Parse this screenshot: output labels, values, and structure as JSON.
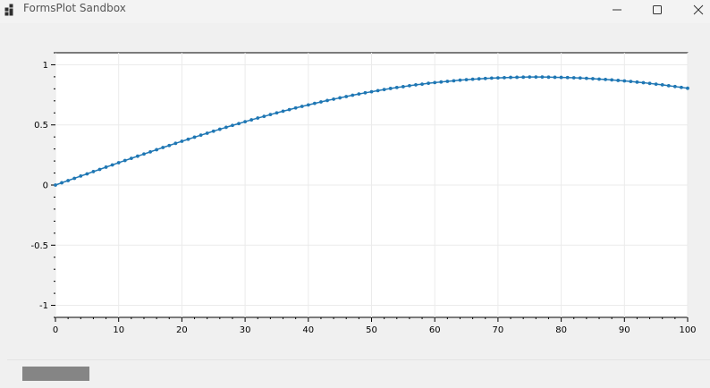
{
  "window": {
    "title": "FormsPlot Sandbox",
    "app_icon": "grid-app-icon",
    "controls": [
      "minimize-icon",
      "maximize-icon",
      "close-icon"
    ]
  },
  "chart_data": {
    "type": "scatter",
    "title": "",
    "xlabel": "",
    "ylabel": "",
    "xlim": [
      0,
      100
    ],
    "ylim": [
      -1.1,
      1.1
    ],
    "x_ticks": [
      "0",
      "10",
      "20",
      "30",
      "40",
      "50",
      "60",
      "70",
      "80",
      "90",
      "100"
    ],
    "y_ticks": [
      "1",
      "0.5",
      "0",
      "-0.5",
      "-1"
    ],
    "grid": true,
    "marker": "circle",
    "line": true,
    "color": "#1f77b4",
    "series": [
      {
        "x": [
          0,
          1,
          2,
          3,
          4,
          5,
          6,
          7,
          8,
          9,
          10,
          11,
          12,
          13,
          14,
          15,
          16,
          17,
          18,
          19,
          20,
          21,
          22,
          23,
          24,
          25,
          26,
          27,
          28,
          29,
          30,
          31,
          32,
          33,
          34,
          35,
          36,
          37,
          38,
          39,
          40,
          41,
          42,
          43,
          44,
          45,
          46,
          47,
          48,
          49,
          50,
          51,
          52,
          53,
          54,
          55,
          56,
          57,
          58,
          59,
          60,
          61,
          62,
          63,
          64,
          65,
          66,
          67,
          68,
          69,
          70,
          71,
          72,
          73,
          74,
          75,
          76,
          77,
          78,
          79,
          80,
          81,
          82,
          83,
          84,
          85,
          86,
          87,
          88,
          89,
          90,
          91,
          92,
          93,
          94,
          95,
          96,
          97,
          98,
          99,
          100
        ],
        "y": [
          0,
          0.019,
          0.037,
          0.056,
          0.075,
          0.093,
          0.112,
          0.13,
          0.149,
          0.167,
          0.186,
          0.204,
          0.222,
          0.24,
          0.258,
          0.276,
          0.294,
          0.312,
          0.329,
          0.347,
          0.364,
          0.381,
          0.398,
          0.415,
          0.431,
          0.448,
          0.464,
          0.48,
          0.496,
          0.511,
          0.527,
          0.542,
          0.557,
          0.571,
          0.586,
          0.6,
          0.614,
          0.627,
          0.641,
          0.654,
          0.666,
          0.679,
          0.691,
          0.703,
          0.714,
          0.725,
          0.736,
          0.747,
          0.757,
          0.767,
          0.776,
          0.785,
          0.794,
          0.803,
          0.811,
          0.818,
          0.826,
          0.833,
          0.839,
          0.846,
          0.852,
          0.857,
          0.862,
          0.867,
          0.872,
          0.876,
          0.88,
          0.883,
          0.886,
          0.889,
          0.891,
          0.893,
          0.895,
          0.896,
          0.897,
          0.898,
          0.898,
          0.898,
          0.897,
          0.896,
          0.895,
          0.894,
          0.892,
          0.89,
          0.887,
          0.884,
          0.881,
          0.878,
          0.874,
          0.87,
          0.866,
          0.861,
          0.856,
          0.851,
          0.845,
          0.839,
          0.833,
          0.826,
          0.819,
          0.812,
          0.805
        ]
      }
    ]
  }
}
